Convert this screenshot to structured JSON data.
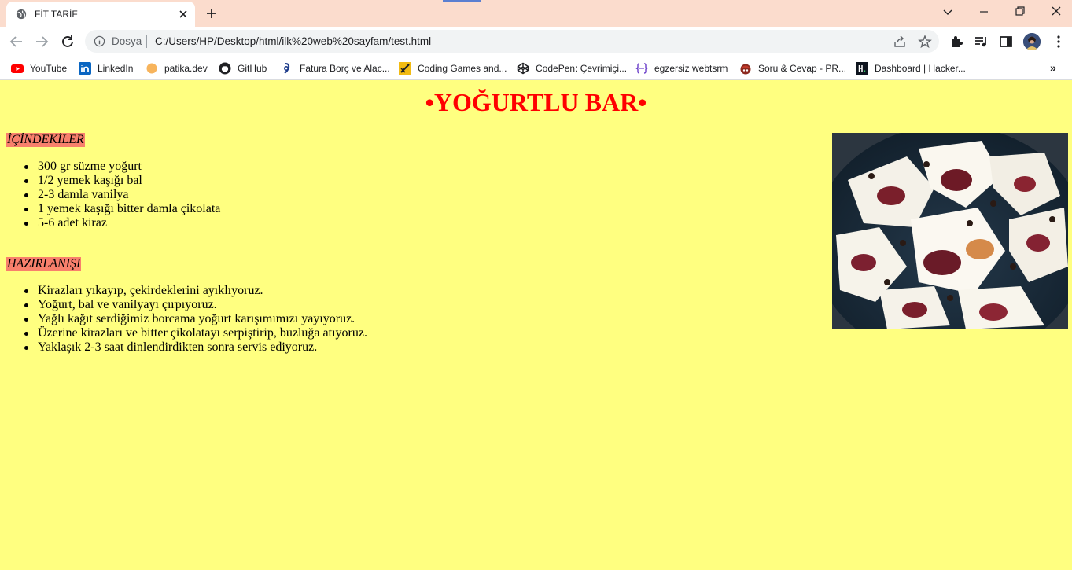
{
  "browser": {
    "tab_title": "FİT TARİF",
    "url_scheme": "Dosya",
    "url": "C:/Users/HP/Desktop/html/ilk%20web%20sayfam/test.html"
  },
  "bookmarks": [
    {
      "label": "YouTube",
      "icon": "youtube-icon"
    },
    {
      "label": "LinkedIn",
      "icon": "linkedin-icon"
    },
    {
      "label": "patika.dev",
      "icon": "patika-icon"
    },
    {
      "label": "GitHub",
      "icon": "github-icon"
    },
    {
      "label": "Fatura Borç ve Alac...",
      "icon": "fatura-icon"
    },
    {
      "label": "Coding Games and...",
      "icon": "codingame-icon"
    },
    {
      "label": "CodePen: Çevrimiçi...",
      "icon": "codepen-icon"
    },
    {
      "label": "egzersiz webtsrm",
      "icon": "code-braces-icon"
    },
    {
      "label": "Soru & Cevap - PR...",
      "icon": "soru-cevap-icon"
    },
    {
      "label": "Dashboard | Hacker...",
      "icon": "hackerrank-icon"
    }
  ],
  "page": {
    "title": "•YOĞURTLU BAR•",
    "ingredients_heading": "İÇİNDEKİLER",
    "ingredients": [
      "300 gr süzme yoğurt",
      "1/2 yemek kaşığı bal",
      "2-3 damla vanilya",
      "1 yemek kaşığı bitter damla çikolata",
      "5-6 adet kiraz"
    ],
    "preparation_heading": "HAZIRLANIŞI",
    "steps": [
      "Kirazları yıkayıp, çekirdeklerini ayıklıyoruz.",
      "Yoğurt, bal ve vanilyayı çırpıyoruz.",
      "Yağlı kağıt serdiğimiz borcama yoğurt karışımımızı yayıyoruz.",
      "Üzerine kirazları ve bitter çikolatayı serpiştirip, buzluğa atıyoruz.",
      "Yaklaşık 2-3 saat dinlendirdikten sonra servis ediyoruz."
    ]
  },
  "colors": {
    "page_background": "#ffff80",
    "title": "#ff0000",
    "heading_highlight": "#f8806c",
    "tabstrip": "#fbdccd"
  }
}
